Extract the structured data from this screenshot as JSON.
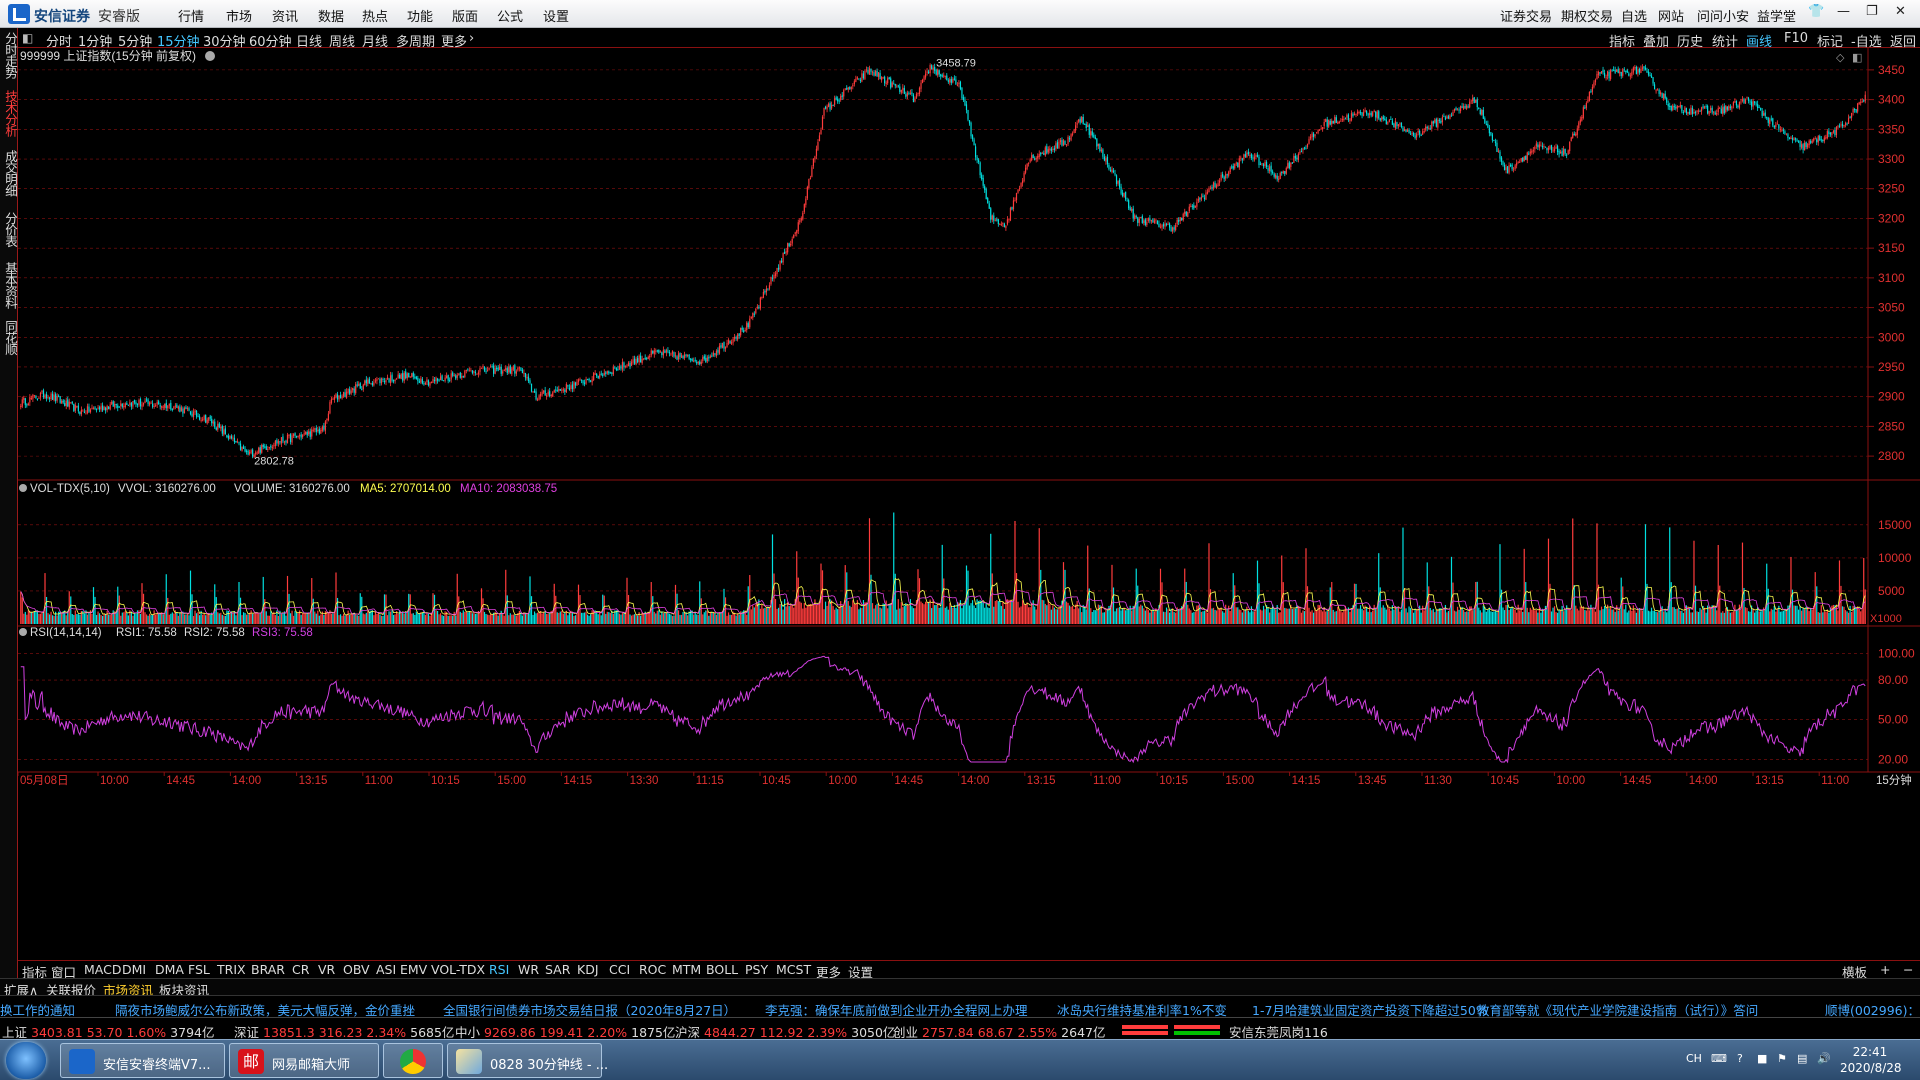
{
  "titlebar": {
    "brand": "安信证券",
    "brand_sub": "安睿版",
    "menus": [
      "行情",
      "市场",
      "资讯",
      "数据",
      "热点",
      "功能",
      "版面",
      "公式",
      "设置"
    ],
    "right_menus": [
      "证券交易",
      "期权交易",
      "自选",
      "网站",
      "问问小安",
      "益学堂"
    ]
  },
  "left_tabs": [
    "分时走势",
    "技术分析",
    "成交明细",
    "分价表",
    "基本资料",
    "同花顺"
  ],
  "periods": [
    "分时",
    "1分钟",
    "5分钟",
    "15分钟",
    "30分钟",
    "60分钟",
    "日线",
    "周线",
    "月线",
    "多周期",
    "更多"
  ],
  "active_period": "15分钟",
  "right_tools": [
    "指标",
    "叠加",
    "历史",
    "统计",
    "画线",
    "F10",
    "标记",
    "-自选",
    "返回"
  ],
  "active_tool": "画线",
  "main": {
    "title": "999999 上证指数(15分钟 前复权)",
    "high_label": "3458.79",
    "low_label": "2802.78",
    "y_ticks": [
      3450,
      3400,
      3350,
      3300,
      3250,
      3200,
      3150,
      3100,
      3050,
      3000,
      2950,
      2900,
      2850,
      2800
    ],
    "ylim": [
      2780,
      3470
    ]
  },
  "vol": {
    "legend_name": "VOL-TDX(5,10)",
    "legend_vvol": "VVOL: 3160276.00",
    "legend_volume": "VOLUME: 3160276.00",
    "legend_ma5": "MA5: 2707014.00",
    "legend_ma10": "MA10: 2083038.75",
    "y_ticks": [
      "15000",
      "10000",
      "5000"
    ],
    "unit": "X1000"
  },
  "rsi": {
    "legend_name": "RSI(14,14,14)",
    "legend_rsi1": "RSI1: 75.58",
    "legend_rsi2": "RSI2: 75.58",
    "legend_rsi3": "RSI3: 75.58",
    "y_ticks": [
      "100.00",
      "80.00",
      "50.00",
      "20.00"
    ]
  },
  "time_axis": [
    "05月08日",
    "10:00",
    "14:45",
    "14:00",
    "13:15",
    "11:00",
    "10:15",
    "15:00",
    "14:15",
    "13:30",
    "11:15",
    "10:45",
    "10:00",
    "14:45",
    "14:00",
    "13:15",
    "11:00",
    "10:15",
    "15:00",
    "14:15",
    "13:45",
    "11:30",
    "10:45",
    "10:00",
    "14:45",
    "14:00",
    "13:15",
    "11:00"
  ],
  "time_axis_right": "15分钟",
  "indicators": [
    "指标",
    "窗口",
    "MACD",
    "DMI",
    "DMA",
    "FSL",
    "TRIX",
    "BRAR",
    "CR",
    "VR",
    "OBV",
    "ASI",
    "EMV",
    "VOL-TDX",
    "RSI",
    "WR",
    "SAR",
    "KDJ",
    "CCI",
    "ROC",
    "MTM",
    "BOLL",
    "PSY",
    "MCST",
    "更多",
    "设置"
  ],
  "active_indicator": "RSI",
  "indicator_right": "横板",
  "info_tabs": [
    "扩展∧",
    "关联报价",
    "市场资讯",
    "板块资讯"
  ],
  "active_info_tab": "市场资讯",
  "news": [
    "换工作的通知",
    "隔夜市场鲍威尔公布新政策，美元大幅反弹，金价重挫",
    "全国银行间债券市场交易结日报（2020年8月27日）",
    "李克强：确保年底前做到企业开办全程网上办理",
    "冰岛央行维持基准利率1%不变",
    "1-7月哈建筑业固定资产投资下降超过50%",
    "教育部等就《现代产业学院建设指南（试行）》答问",
    "顺博(002996)：["
  ],
  "indices": [
    {
      "name": "上证",
      "price": "3403.81",
      "chg": "53.70",
      "pct": "1.60%",
      "vol": "3794亿"
    },
    {
      "name": "深证",
      "price": "13851.3",
      "chg": "316.23",
      "pct": "2.34%",
      "vol": "5685亿"
    },
    {
      "name": "中小",
      "price": "9269.86",
      "chg": "199.41",
      "pct": "2.20%",
      "vol": "1875亿"
    },
    {
      "name": "沪深",
      "price": "4844.27",
      "chg": "112.92",
      "pct": "2.39%",
      "vol": "3050亿"
    },
    {
      "name": "创业",
      "price": "2757.84",
      "chg": "68.67",
      "pct": "2.55%",
      "vol": "2647亿"
    }
  ],
  "broker_label": "安信东莞凤岗116",
  "taskbar": {
    "items": [
      "安信安睿终端V7...",
      "网易邮箱大师",
      "",
      "0828 30分钟线 - ..."
    ],
    "tray_lang": "CH",
    "time": "22:41",
    "date": "2020/8/28"
  },
  "colors": {
    "up": "#ff3c3c",
    "down": "#00e0e0",
    "ma5": "#ffff50",
    "ma10": "#e040e0",
    "rsi": "#d040e0",
    "accent": "#45c6ff",
    "grid": "#8a1010"
  },
  "chart_data": [
    {
      "type": "candlestick",
      "title": "999999 上证指数(15分钟 前复权)",
      "ylim": [
        2780,
        3470
      ],
      "key_points": [
        {
          "i": 0,
          "v": 2890
        },
        {
          "i": 16,
          "v": 2905
        },
        {
          "i": 40,
          "v": 2875
        },
        {
          "i": 70,
          "v": 2890
        },
        {
          "i": 100,
          "v": 2885
        },
        {
          "i": 125,
          "v": 2860
        },
        {
          "i": 150,
          "v": 2803
        },
        {
          "i": 170,
          "v": 2825
        },
        {
          "i": 200,
          "v": 2845
        },
        {
          "i": 205,
          "v": 2895
        },
        {
          "i": 230,
          "v": 2925
        },
        {
          "i": 255,
          "v": 2935
        },
        {
          "i": 270,
          "v": 2925
        },
        {
          "i": 300,
          "v": 2945
        },
        {
          "i": 330,
          "v": 2945
        },
        {
          "i": 340,
          "v": 2900
        },
        {
          "i": 360,
          "v": 2915
        },
        {
          "i": 390,
          "v": 2945
        },
        {
          "i": 420,
          "v": 2975
        },
        {
          "i": 450,
          "v": 2960
        },
        {
          "i": 480,
          "v": 3020
        },
        {
          "i": 500,
          "v": 3120
        },
        {
          "i": 515,
          "v": 3200
        },
        {
          "i": 530,
          "v": 3380
        },
        {
          "i": 560,
          "v": 3450
        },
        {
          "i": 590,
          "v": 3400
        },
        {
          "i": 600,
          "v": 3455
        },
        {
          "i": 620,
          "v": 3420
        },
        {
          "i": 640,
          "v": 3200
        },
        {
          "i": 650,
          "v": 3190
        },
        {
          "i": 665,
          "v": 3300
        },
        {
          "i": 690,
          "v": 3330
        },
        {
          "i": 700,
          "v": 3370
        },
        {
          "i": 720,
          "v": 3280
        },
        {
          "i": 735,
          "v": 3200
        },
        {
          "i": 760,
          "v": 3185
        },
        {
          "i": 785,
          "v": 3250
        },
        {
          "i": 810,
          "v": 3310
        },
        {
          "i": 830,
          "v": 3270
        },
        {
          "i": 860,
          "v": 3360
        },
        {
          "i": 890,
          "v": 3380
        },
        {
          "i": 920,
          "v": 3340
        },
        {
          "i": 940,
          "v": 3370
        },
        {
          "i": 960,
          "v": 3400
        },
        {
          "i": 980,
          "v": 3280
        },
        {
          "i": 1000,
          "v": 3320
        },
        {
          "i": 1020,
          "v": 3310
        },
        {
          "i": 1040,
          "v": 3440
        },
        {
          "i": 1070,
          "v": 3450
        },
        {
          "i": 1090,
          "v": 3385
        },
        {
          "i": 1120,
          "v": 3380
        },
        {
          "i": 1140,
          "v": 3400
        },
        {
          "i": 1160,
          "v": 3350
        },
        {
          "i": 1175,
          "v": 3320
        },
        {
          "i": 1200,
          "v": 3350
        },
        {
          "i": 1217,
          "v": 3404
        }
      ]
    },
    {
      "type": "bar",
      "title": "VOL-TDX(5,10)",
      "ylim": [
        0,
        18000
      ]
    },
    {
      "type": "line",
      "title": "RSI(14,14,14)",
      "ylim": [
        15,
        105
      ],
      "last": 75.58
    }
  ]
}
